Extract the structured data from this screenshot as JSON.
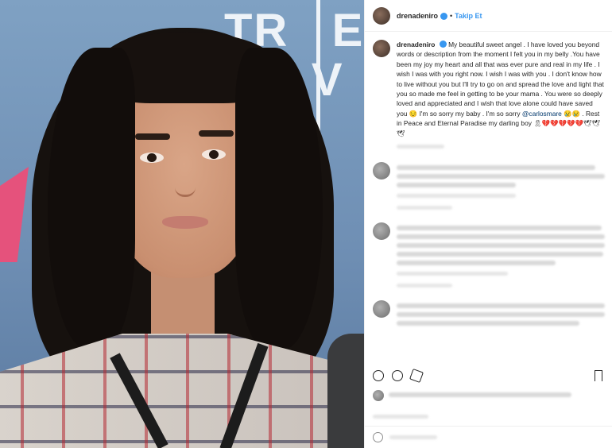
{
  "post": {
    "username": "drenadeniro",
    "follow_label": "Takip Et",
    "separator": "•",
    "caption": {
      "username": "drenadeniro",
      "text_before_mention": "My beautiful sweet angel . I have loved you beyond words or description from the moment I felt you in my belly .You have been my joy my heart and all that was ever pure and real in my life . I wish I was with you right now. I wish I was with you . I don't know how to live without you but I'll try to go on and spread the love and light that you so made me feel in getting to be your mama . You were so deeply loved and appreciated and I wish that love alone could have saved you 😔 I'm so sorry my baby . I'm so sorry ",
      "mention": "@carlosmare",
      "text_after_mention": " 😢😢 . Rest in Peace and Eternal Paradise my darling boy 🎗💔💔💔💔💔🕊🕊🕊"
    }
  },
  "photo": {
    "background_letters": [
      "TR   E",
      "T    V"
    ]
  },
  "colors": {
    "accent": "#3897f0",
    "mention": "#00376b",
    "text": "#262626"
  },
  "icons": [
    "verified-badge-icon",
    "heart-icon",
    "comment-icon",
    "share-icon",
    "bookmark-icon",
    "smiley-icon"
  ]
}
